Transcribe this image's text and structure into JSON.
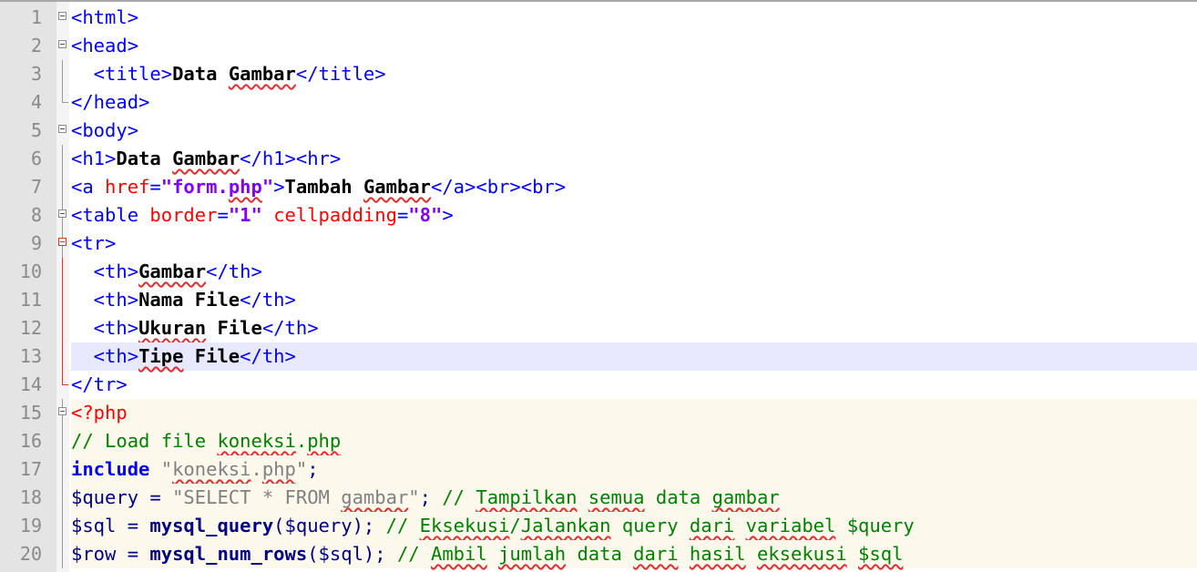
{
  "editor": {
    "lines": [
      {
        "n": "1",
        "fold": "box",
        "guide": "none",
        "segs": [
          [
            "tag",
            "<html>"
          ]
        ]
      },
      {
        "n": "2",
        "fold": "box",
        "guide": "none",
        "segs": [
          [
            "tag",
            "<head>"
          ]
        ]
      },
      {
        "n": "3",
        "fold": "",
        "guide": "line",
        "segs": [
          [
            "tag",
            "  <title>"
          ],
          [
            "txtw",
            "Data "
          ],
          [
            "txtw sp",
            "Gambar"
          ],
          [
            "tag",
            "</title>"
          ]
        ]
      },
      {
        "n": "4",
        "fold": "",
        "guide": "end",
        "segs": [
          [
            "tag",
            "</head>"
          ]
        ]
      },
      {
        "n": "5",
        "fold": "box",
        "guide": "none",
        "segs": [
          [
            "tag",
            "<body>"
          ]
        ]
      },
      {
        "n": "6",
        "fold": "",
        "guide": "line",
        "segs": [
          [
            "tag",
            "<h1>"
          ],
          [
            "txtw",
            "Data "
          ],
          [
            "txtw sp",
            "Gambar"
          ],
          [
            "tag",
            "</h1><hr>"
          ]
        ]
      },
      {
        "n": "7",
        "fold": "",
        "guide": "line",
        "segs": [
          [
            "tag",
            "<a "
          ],
          [
            "attr",
            "href"
          ],
          [
            "tag",
            "="
          ],
          [
            "str",
            "\"form."
          ],
          [
            "str sp",
            "php"
          ],
          [
            "str",
            "\""
          ],
          [
            "tag",
            ">"
          ],
          [
            "txtw",
            "Tambah "
          ],
          [
            "txtw sp",
            "Gambar"
          ],
          [
            "tag",
            "</a><br><br>"
          ]
        ]
      },
      {
        "n": "8",
        "fold": "box",
        "guide": "line",
        "segs": [
          [
            "tag",
            "<table "
          ],
          [
            "attr",
            "border"
          ],
          [
            "tag",
            "="
          ],
          [
            "str",
            "\"1\""
          ],
          [
            "tag",
            " "
          ],
          [
            "attr",
            "cellpadding"
          ],
          [
            "tag",
            "="
          ],
          [
            "str",
            "\"8\""
          ],
          [
            "tag",
            ">"
          ]
        ]
      },
      {
        "n": "9",
        "fold": "boxred",
        "guide": "line",
        "segs": [
          [
            "tag",
            "<tr>"
          ]
        ]
      },
      {
        "n": "10",
        "fold": "",
        "guide": "red",
        "segs": [
          [
            "tag",
            "  <th>"
          ],
          [
            "txtw sp",
            "Gambar"
          ],
          [
            "tag",
            "</th>"
          ]
        ]
      },
      {
        "n": "11",
        "fold": "",
        "guide": "red",
        "segs": [
          [
            "tag",
            "  <th>"
          ],
          [
            "txtw",
            "Nama File"
          ],
          [
            "tag",
            "</th>"
          ]
        ]
      },
      {
        "n": "12",
        "fold": "",
        "guide": "red",
        "segs": [
          [
            "tag",
            "  <th>"
          ],
          [
            "txtw sp",
            "Ukuran"
          ],
          [
            "txtw",
            " File"
          ],
          [
            "tag",
            "</th>"
          ]
        ]
      },
      {
        "n": "13",
        "fold": "",
        "guide": "red",
        "hl": true,
        "segs": [
          [
            "tag",
            "  <th>"
          ],
          [
            "txtw sp",
            "Tipe"
          ],
          [
            "txtw",
            " File"
          ],
          [
            "tag",
            "</th>"
          ]
        ]
      },
      {
        "n": "14",
        "fold": "",
        "guide": "redend",
        "segs": [
          [
            "tag",
            "</tr>"
          ]
        ]
      },
      {
        "n": "15",
        "fold": "box",
        "guide": "line",
        "php": true,
        "segs": [
          [
            "php",
            "<?php"
          ]
        ]
      },
      {
        "n": "16",
        "fold": "",
        "guide": "line",
        "php": true,
        "segs": [
          [
            "cmt",
            "// Load file "
          ],
          [
            "cmt sp",
            "koneksi"
          ],
          [
            "cmt",
            "."
          ],
          [
            "cmt sp",
            "php"
          ]
        ]
      },
      {
        "n": "17",
        "fold": "",
        "guide": "line",
        "php": true,
        "segs": [
          [
            "kw",
            "include"
          ],
          [
            "plain",
            " "
          ],
          [
            "dstr",
            "\""
          ],
          [
            "dstr sp",
            "koneksi"
          ],
          [
            "dstr",
            "."
          ],
          [
            "dstr sp",
            "php"
          ],
          [
            "dstr",
            "\""
          ],
          [
            "plain",
            ";"
          ]
        ]
      },
      {
        "n": "18",
        "fold": "",
        "guide": "line",
        "php": true,
        "segs": [
          [
            "var",
            "$query"
          ],
          [
            "plain",
            " = "
          ],
          [
            "dstr",
            "\"SELECT * FROM "
          ],
          [
            "dstr sp",
            "gambar"
          ],
          [
            "dstr",
            "\""
          ],
          [
            "plain",
            "; "
          ],
          [
            "cmt",
            "// "
          ],
          [
            "cmt sp",
            "Tampilkan"
          ],
          [
            "cmt",
            " "
          ],
          [
            "cmt sp",
            "semua"
          ],
          [
            "cmt",
            " data "
          ],
          [
            "cmt sp",
            "gambar"
          ]
        ]
      },
      {
        "n": "19",
        "fold": "",
        "guide": "line",
        "php": true,
        "segs": [
          [
            "var",
            "$sql"
          ],
          [
            "plain",
            " = "
          ],
          [
            "fn",
            "mysql_query"
          ],
          [
            "plain",
            "("
          ],
          [
            "var",
            "$query"
          ],
          [
            "plain",
            "); "
          ],
          [
            "cmt",
            "// "
          ],
          [
            "cmt sp",
            "Eksekusi"
          ],
          [
            "cmt",
            "/"
          ],
          [
            "cmt sp",
            "Jalankan"
          ],
          [
            "cmt",
            " query "
          ],
          [
            "cmt sp",
            "dari"
          ],
          [
            "cmt",
            " "
          ],
          [
            "cmt sp",
            "variabel"
          ],
          [
            "cmt",
            " $query"
          ]
        ]
      },
      {
        "n": "20",
        "fold": "",
        "guide": "line",
        "php": true,
        "segs": [
          [
            "var",
            "$row"
          ],
          [
            "plain",
            " = "
          ],
          [
            "fn",
            "mysql_num_rows"
          ],
          [
            "plain",
            "("
          ],
          [
            "var",
            "$sql"
          ],
          [
            "plain",
            "); "
          ],
          [
            "cmt",
            "// "
          ],
          [
            "cmt sp",
            "Ambil"
          ],
          [
            "cmt",
            " "
          ],
          [
            "cmt sp",
            "jumlah"
          ],
          [
            "cmt",
            " data "
          ],
          [
            "cmt sp",
            "dari"
          ],
          [
            "cmt",
            " "
          ],
          [
            "cmt sp",
            "hasil"
          ],
          [
            "cmt",
            " "
          ],
          [
            "cmt sp",
            "eksekusi"
          ],
          [
            "cmt",
            " "
          ],
          [
            "cmt sp",
            "$sql"
          ]
        ]
      }
    ]
  },
  "colors": {
    "tag": "#0000ff",
    "attribute": "#ff0000",
    "string": "#8000ff",
    "comment": "#008000",
    "current_line": "#e8e8ff",
    "gutter": "#e4e4e4"
  }
}
